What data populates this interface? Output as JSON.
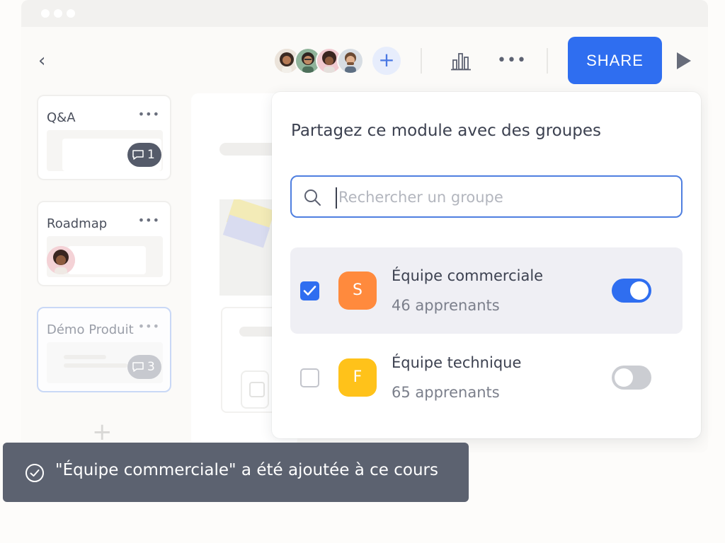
{
  "window": {
    "title_dots": 3
  },
  "toolbar": {
    "members": [
      "woman-with-curly-hair",
      "woman-with-glasses",
      "woman-with-afro",
      "man-with-beard"
    ],
    "add_member_icon": "plus-icon",
    "stats_icon": "bar-chart-icon",
    "more_icon": "more-horizontal-icon",
    "more_label": "•••",
    "share_label": "SHARE",
    "play_icon": "play-icon",
    "back_label": "‹",
    "add_member_label": "+"
  },
  "cards": [
    {
      "title": "Q&A",
      "more": "•••",
      "comments": "1"
    },
    {
      "title": "Roadmap",
      "more": "•••"
    },
    {
      "title": "Démo Produit",
      "more": "•••",
      "comments": "3"
    }
  ],
  "add_card_label": "+",
  "share_panel": {
    "title": "Partagez ce module avec des groupes",
    "search": {
      "placeholder": "Rechercher un groupe",
      "value": ""
    },
    "groups": [
      {
        "initial": "S",
        "name": "Équipe commerciale",
        "count": "46 apprenants",
        "checked": true,
        "enabled": true,
        "color": "#ff8a3d"
      },
      {
        "initial": "F",
        "name": "Équipe technique",
        "count": "65 apprenants",
        "checked": false,
        "enabled": false,
        "color": "#ffc21a"
      }
    ]
  },
  "toast": {
    "icon": "check-circle-icon",
    "message": "\"Équipe commerciale\" a été ajoutée à ce cours"
  },
  "colors": {
    "accent": "#2f6ef0",
    "toast_bg": "#5c6270",
    "group_s": "#ff8a3d",
    "group_f": "#ffc21a"
  }
}
